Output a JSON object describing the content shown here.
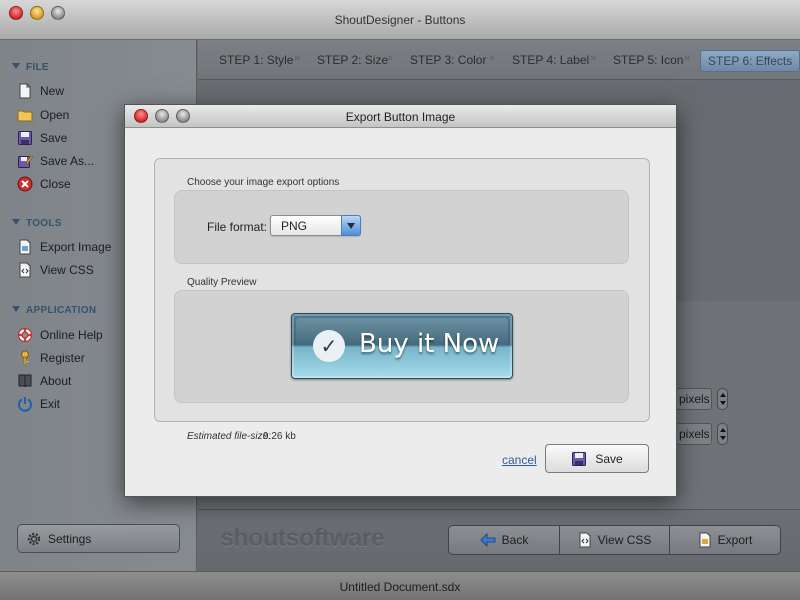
{
  "window": {
    "title": "ShoutDesigner - Buttons"
  },
  "sidebar": {
    "file_header": "FILE",
    "file_items": [
      {
        "label": "New",
        "icon": "new-document-icon"
      },
      {
        "label": "Open",
        "icon": "folder-icon"
      },
      {
        "label": "Save",
        "icon": "floppy-disk-icon"
      },
      {
        "label": "Save As...",
        "icon": "save-as-icon"
      },
      {
        "label": "Close",
        "icon": "close-icon"
      }
    ],
    "tools_header": "TOOLS",
    "tools_items": [
      {
        "label": "Export Image",
        "icon": "export-image-icon"
      },
      {
        "label": "View CSS",
        "icon": "css-document-icon"
      }
    ],
    "application_header": "APPLICATION",
    "application_items": [
      {
        "label": "Online Help",
        "icon": "lifebuoy-icon"
      },
      {
        "label": "Register",
        "icon": "key-icon"
      },
      {
        "label": "About",
        "icon": "book-icon"
      },
      {
        "label": "Exit",
        "icon": "power-icon"
      }
    ],
    "settings_label": "Settings"
  },
  "steps": [
    {
      "label": "STEP 1: Style",
      "active": false
    },
    {
      "label": "STEP 2: Size",
      "active": false
    },
    {
      "label": "STEP 3: Color",
      "active": false
    },
    {
      "label": "STEP 4: Label",
      "active": false
    },
    {
      "label": "STEP 5: Icon",
      "active": false
    },
    {
      "label": "STEP 6: Effects",
      "active": true
    }
  ],
  "content": {
    "pixel_unit_1": "pixels",
    "pixel_unit_2": "pixels"
  },
  "bottombar": {
    "brand": "shoutsoftware",
    "back_label": "Back",
    "viewcss_label": "View CSS",
    "export_label": "Export"
  },
  "status": {
    "document_name": "Untitled Document.sdx"
  },
  "dialog": {
    "title": "Export Button Image",
    "options_heading": "Choose your image export options",
    "format_label": "File format:",
    "format_value": "PNG",
    "preview_heading": "Quality Preview",
    "preview_button_text": "Buy it Now",
    "filesize_label": "Estimated file-size:",
    "filesize_value": "9.26 kb",
    "cancel_label": "cancel",
    "save_label": "Save"
  },
  "colors": {
    "active_step": "#7f9bb9",
    "preview_button_top": "#3c6478",
    "preview_button_bottom": "#a7dbea",
    "link": "#2f5f92"
  }
}
